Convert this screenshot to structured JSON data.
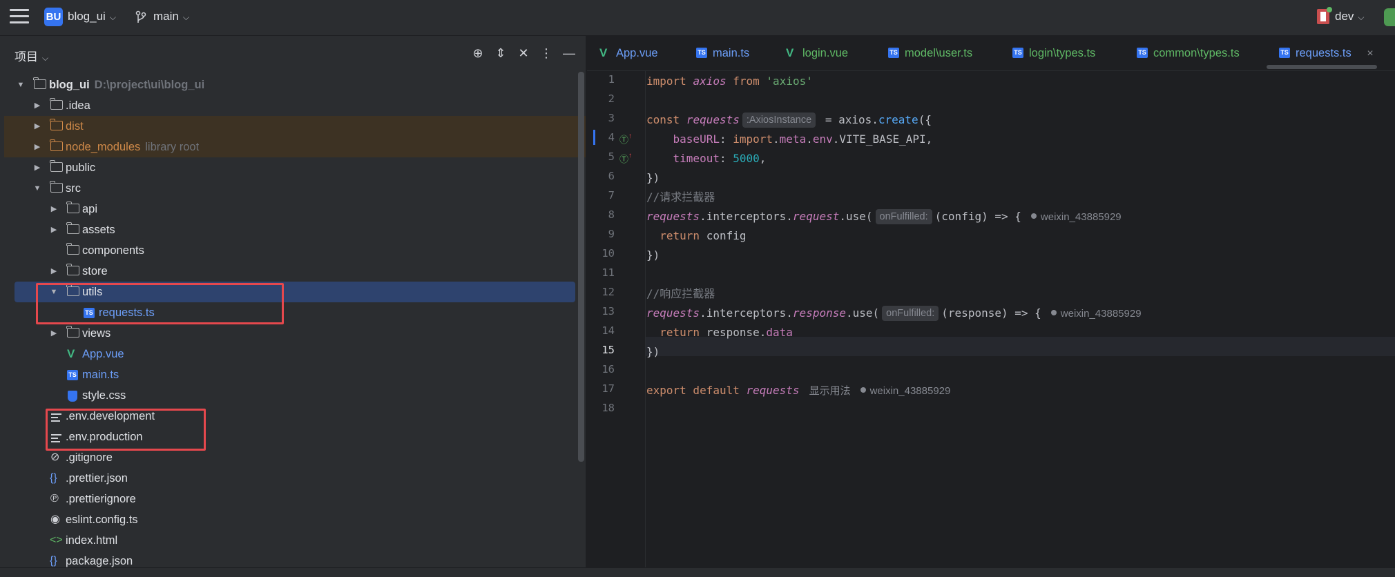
{
  "titlebar": {
    "project_badge": "BU",
    "project_name": "blog_ui",
    "branch": "main",
    "profile": "dev"
  },
  "project_panel": {
    "title": "项目",
    "tree": [
      {
        "label": "blog_ui",
        "hint": "D:\\project\\ui\\blog_ui"
      },
      {
        "label": ".idea"
      },
      {
        "label": "dist"
      },
      {
        "label": "node_modules",
        "hint": "library root"
      },
      {
        "label": "public"
      },
      {
        "label": "src"
      },
      {
        "label": "api"
      },
      {
        "label": "assets"
      },
      {
        "label": "components"
      },
      {
        "label": "store"
      },
      {
        "label": "utils"
      },
      {
        "label": "requests.ts"
      },
      {
        "label": "views"
      },
      {
        "label": "App.vue"
      },
      {
        "label": "main.ts"
      },
      {
        "label": "style.css"
      },
      {
        "label": ".env.development"
      },
      {
        "label": ".env.production"
      },
      {
        "label": ".gitignore"
      },
      {
        "label": ".prettier.json"
      },
      {
        "label": ".prettierignore"
      },
      {
        "label": "eslint.config.ts"
      },
      {
        "label": "index.html"
      },
      {
        "label": "package.json"
      }
    ]
  },
  "editor": {
    "tabs": [
      {
        "label": "App.vue"
      },
      {
        "label": "main.ts"
      },
      {
        "label": "login.vue"
      },
      {
        "label": "model\\user.ts"
      },
      {
        "label": "login\\types.ts"
      },
      {
        "label": "common\\types.ts"
      },
      {
        "label": "requests.ts",
        "close": "×"
      }
    ],
    "line_numbers": [
      "1",
      "2",
      "3",
      "4",
      "5",
      "6",
      "7",
      "8",
      "9",
      "10",
      "11",
      "12",
      "13",
      "14",
      "15",
      "16",
      "17",
      "18"
    ],
    "current_line": 15,
    "code": {
      "l1_import": "import",
      "l1_name": "axios",
      "l1_from": "from",
      "l1_str": "'axios'",
      "l3_const": "const",
      "l3_var": "requests",
      "l3_hint": ":AxiosInstance",
      "l3_eq": " = axios.",
      "l3_fn": "create",
      "l3_end": "({",
      "l4_key": "baseURL",
      "l4_rest_a": ": ",
      "l4_import": "import",
      "l4_dot1": ".",
      "l4_meta": "meta",
      "l4_dot2": ".",
      "l4_env": "env",
      "l4_rest_b": ".VITE_BASE_API,",
      "l5_key": "timeout",
      "l5_colon": ": ",
      "l5_num": "5000",
      "l5_comma": ",",
      "l6": "})",
      "l7": "//请求拦截器",
      "l8_var": "requests",
      "l8_a": ".interceptors.",
      "l8_req": "request",
      "l8_b": ".use(",
      "l8_hint": "onFulfilled:",
      "l8_c": "(config) => {",
      "l9_ret": "return",
      "l9_val": " config",
      "l10": "})",
      "l12": "//响应拦截器",
      "l13_var": "requests",
      "l13_a": ".interceptors.",
      "l13_res": "response",
      "l13_b": ".use(",
      "l13_hint": "onFulfilled:",
      "l13_c": "(response) => {",
      "l14_ret": "return",
      "l14_val": " response.",
      "l14_prop": "data",
      "l15": "})",
      "l17_export": "export default",
      "l17_var": "requests",
      "l17_usage": "显示用法"
    },
    "author": "weixin_43885929"
  }
}
